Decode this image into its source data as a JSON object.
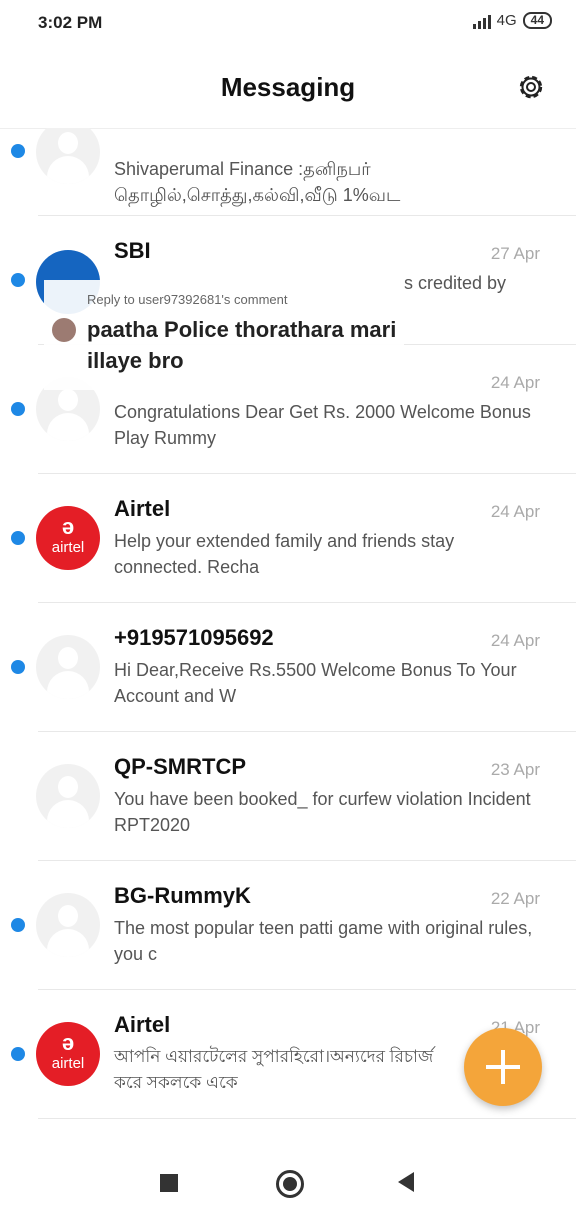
{
  "status": {
    "time": "3:02 PM",
    "network": "4G",
    "battery": "44"
  },
  "header": {
    "title": "Messaging"
  },
  "overlay": {
    "reply_to": "Reply to user97392681's comment",
    "comment": "paatha Police thorathara mari illaye bro"
  },
  "conversations": [
    {
      "name": "",
      "date": "",
      "preview": "Shivaperumal Finance :தனிநபர் தொழில்,சொத்து,கல்வி,வீடு 1%வட",
      "unread": true,
      "avatar": "placeholder"
    },
    {
      "name": "SBI",
      "date": "27 Apr",
      "preview": "s credited by",
      "unread": true,
      "avatar": "sbi"
    },
    {
      "name": "",
      "date": "24 Apr",
      "preview": "Congratulations Dear Get Rs. 2000 Welcome Bonus Play Rummy",
      "unread": true,
      "avatar": "placeholder"
    },
    {
      "name": "Airtel",
      "date": "24 Apr",
      "preview": "Help your extended family and friends stay connected. Recha",
      "unread": true,
      "avatar": "airtel"
    },
    {
      "name": "+919571095692",
      "date": "24 Apr",
      "preview": "Hi Dear,Receive Rs.5500 Welcome Bonus To Your Account and W",
      "unread": true,
      "avatar": "placeholder"
    },
    {
      "name": "QP-SMRTCP",
      "date": "23 Apr",
      "preview": "You have been booked_ for curfew violation Incident RPT2020",
      "unread": false,
      "avatar": "placeholder"
    },
    {
      "name": "BG-RummyK",
      "date": "22 Apr",
      "preview": "The most popular teen patti game with original rules, you c",
      "unread": true,
      "avatar": "placeholder"
    },
    {
      "name": "Airtel",
      "date": "21 Apr",
      "preview": "আপনি এয়ারটেলের সুপারহিরো।অন্যদের রিচার্জ করে সকলকে একে",
      "unread": true,
      "avatar": "airtel"
    }
  ],
  "airtel_logo_text": "airtel",
  "icons": {
    "settings": "gear-icon",
    "fab": "plus-icon",
    "nav": [
      "recent-apps-icon",
      "home-icon",
      "back-icon"
    ]
  },
  "colors": {
    "unread_dot": "#1e88e5",
    "fab": "#f4a53a",
    "airtel": "#e41e26"
  }
}
